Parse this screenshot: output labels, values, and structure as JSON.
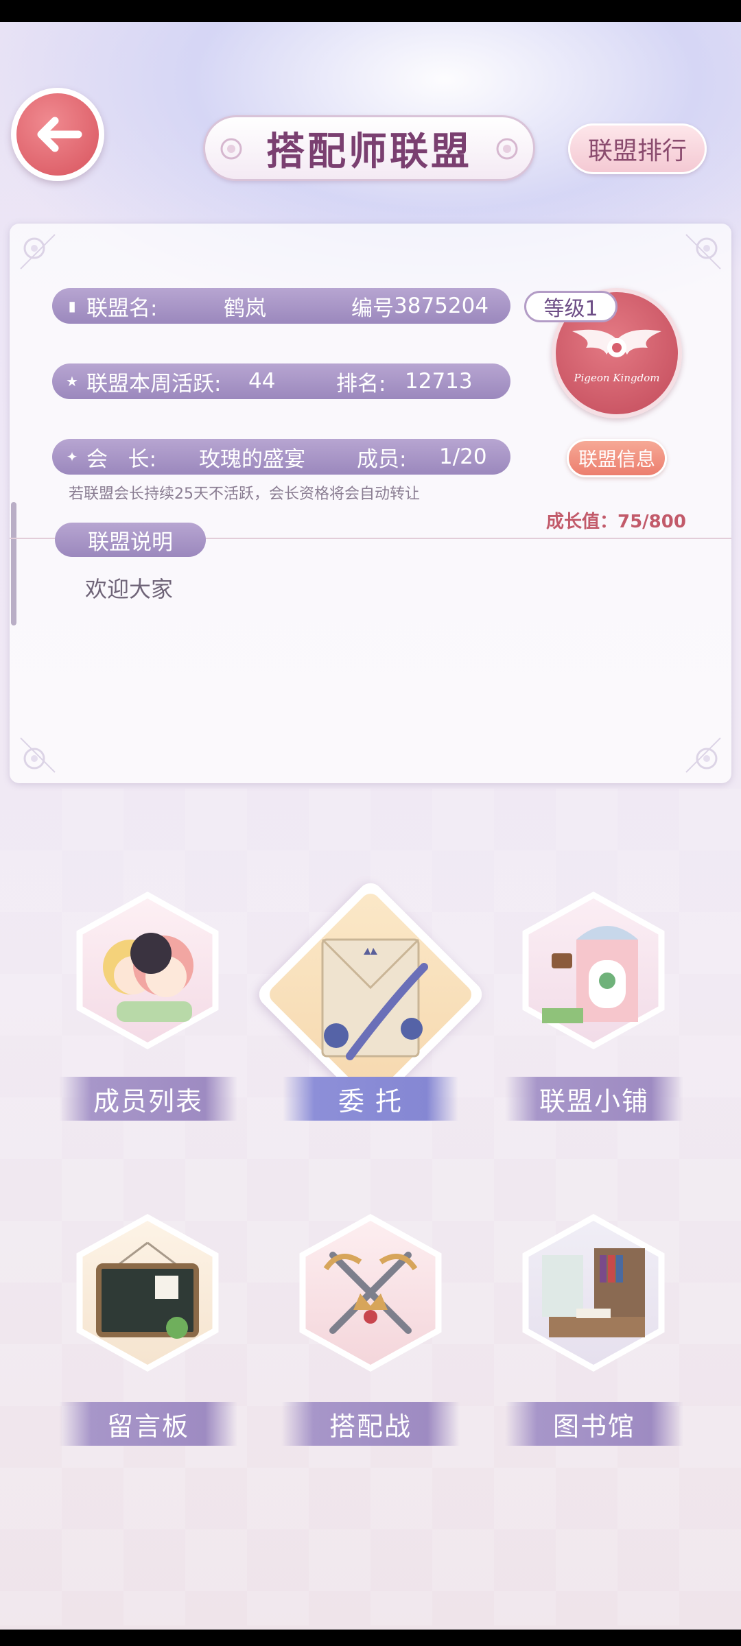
{
  "header": {
    "title": "搭配师联盟",
    "rank_button": "联盟排行"
  },
  "alliance": {
    "name_label": "联盟名:",
    "name_value": "鹤岚",
    "id_label": "编号",
    "id_value": "3875204",
    "activity_label": "联盟本周活跃:",
    "activity_value": "44",
    "rank_label": "排名:",
    "rank_value": "12713",
    "leader_label": "会   长:",
    "leader_value": "玫瑰的盛宴",
    "members_label": "成员:",
    "members_value": "1/20",
    "note": "若联盟会长持续25天不活跃，会长资格将会自动转让",
    "level": "等级1",
    "emblem_text": "Pigeon Kingdom",
    "info_button": "联盟信息",
    "growth": "成长值：75/800",
    "desc_label": "联盟说明",
    "desc_text": "欢迎大家"
  },
  "menu": {
    "members": "成员列表",
    "commission": "委  托",
    "shop": "联盟小铺",
    "board": "留言板",
    "battle": "搭配战",
    "library": "图书馆"
  },
  "colors": {
    "accent": "#9b88bd",
    "title": "#7a3f70",
    "back_button": "#d8545e",
    "info_button": "#ec7e6e"
  }
}
